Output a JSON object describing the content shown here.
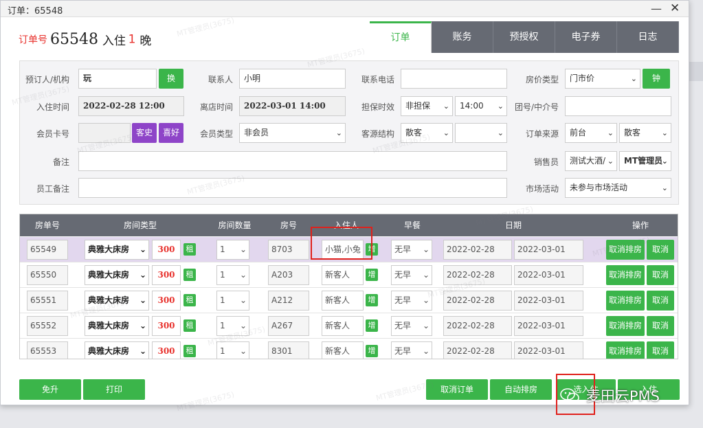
{
  "window": {
    "title": "订单：65548",
    "minimize": "—",
    "close": "✕"
  },
  "header": {
    "order_label": "订单号",
    "order_no": "65548",
    "checkin_text": "入住",
    "nights": "1",
    "nights_unit": "晚"
  },
  "tabs": [
    {
      "label": "订单",
      "active": true
    },
    {
      "label": "账务",
      "active": false
    },
    {
      "label": "预授权",
      "active": false
    },
    {
      "label": "电子券",
      "active": false
    },
    {
      "label": "日志",
      "active": false
    }
  ],
  "form": {
    "booker_label": "预订人/机构",
    "booker_value": "玩",
    "booker_btn": "换",
    "contact_label": "联系人",
    "contact_value": "小明",
    "phone_label": "联系电话",
    "phone_value": "",
    "rate_type_label": "房价类型",
    "rate_type_value": "门市价",
    "rate_type_btn": "钟",
    "checkin_label": "入住时间",
    "checkin_value": "2022-02-28 12:00",
    "checkout_label": "离店时间",
    "checkout_value": "2022-03-01 14:00",
    "guarantee_label": "担保时效",
    "guarantee_value": "非担保",
    "guarantee_time": "14:00",
    "group_label": "团号/中介号",
    "group_value": "",
    "member_label": "会员卡号",
    "member_value": "",
    "history_btn": "客史",
    "pref_btn": "喜好",
    "member_type_label": "会员类型",
    "member_type_value": "非会员",
    "source_struct_label": "客源结构",
    "source_struct_value": "散客",
    "source_struct_value2": "",
    "order_source_label": "订单来源",
    "order_source_value": "前台",
    "order_source_value2": "散客",
    "remark_label": "备注",
    "remark_value": "",
    "sales_label": "销售员",
    "sales_value": "测试大酒/",
    "sales_value2": "MT管理员",
    "staff_remark_label": "员工备注",
    "staff_remark_value": "",
    "market_label": "市场活动",
    "market_value": "未参与市场活动"
  },
  "table": {
    "headers": [
      "房单号",
      "房间类型",
      "房间数量",
      "房号",
      "入住人",
      "早餐",
      "日期",
      "操作"
    ],
    "rows": [
      {
        "id": "65549",
        "type": "典雅大床房",
        "price": "300",
        "rent": "租",
        "qty": "1",
        "room": "8703",
        "guest": "小猫,小兔",
        "add": "增",
        "breakfast": "无早",
        "from": "2022-02-28",
        "to": "2022-03-01",
        "cancel_assign": "取消排房",
        "cancel": "取消",
        "selected": true
      },
      {
        "id": "65550",
        "type": "典雅大床房",
        "price": "300",
        "rent": "租",
        "qty": "1",
        "room": "A203",
        "guest": "新客人",
        "add": "增",
        "breakfast": "无早",
        "from": "2022-02-28",
        "to": "2022-03-01",
        "cancel_assign": "取消排房",
        "cancel": "取消",
        "selected": false
      },
      {
        "id": "65551",
        "type": "典雅大床房",
        "price": "300",
        "rent": "租",
        "qty": "1",
        "room": "A212",
        "guest": "新客人",
        "add": "增",
        "breakfast": "无早",
        "from": "2022-02-28",
        "to": "2022-03-01",
        "cancel_assign": "取消排房",
        "cancel": "取消",
        "selected": false
      },
      {
        "id": "65552",
        "type": "典雅大床房",
        "price": "300",
        "rent": "租",
        "qty": "1",
        "room": "A267",
        "guest": "新客人",
        "add": "增",
        "breakfast": "无早",
        "from": "2022-02-28",
        "to": "2022-03-01",
        "cancel_assign": "取消排房",
        "cancel": "取消",
        "selected": false
      },
      {
        "id": "65553",
        "type": "典雅大床房",
        "price": "300",
        "rent": "租",
        "qty": "1",
        "room": "8301",
        "guest": "新客人",
        "add": "增",
        "breakfast": "无早",
        "from": "2022-02-28",
        "to": "2022-03-01",
        "cancel_assign": "取消排房",
        "cancel": "取消",
        "selected": false
      }
    ]
  },
  "footer": {
    "upgrade_btn": "免升",
    "print_btn": "打印",
    "cancel_order_btn": "取消订单",
    "auto_assign_btn": "自动排房",
    "checkin_sel_btn": "选入住",
    "checkin_btn": "入住"
  },
  "watermark": "MT管理员(3675)",
  "brand": "麦田云PMS",
  "colors": {
    "accent_green": "#3bb54a",
    "purple": "#8e44c8",
    "red": "#e8322d",
    "tab_dark": "#666a73",
    "highlight_box": "#e0201b"
  }
}
